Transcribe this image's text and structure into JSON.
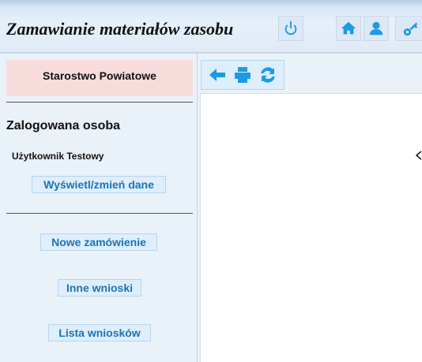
{
  "header": {
    "title": "Zamawianie materiałów zasobu",
    "icons": [
      "power-icon",
      "home-icon",
      "user-icon",
      "key-icon"
    ],
    "accent_color": "#1a9be6"
  },
  "sidebar": {
    "organization": "Starostwo Powiatowe",
    "logged_in_heading": "Zalogowana osoba",
    "user_name": "Użytkownik Testowy",
    "edit_profile_label": "Wyświetl/zmień dane",
    "nav": {
      "new_order": "Nowe zamówienie",
      "other_requests": "Inne wnioski",
      "request_list": "Lista wniosków"
    }
  },
  "toolbar": {
    "icons": [
      "back-arrow-icon",
      "print-icon",
      "refresh-icon"
    ]
  }
}
